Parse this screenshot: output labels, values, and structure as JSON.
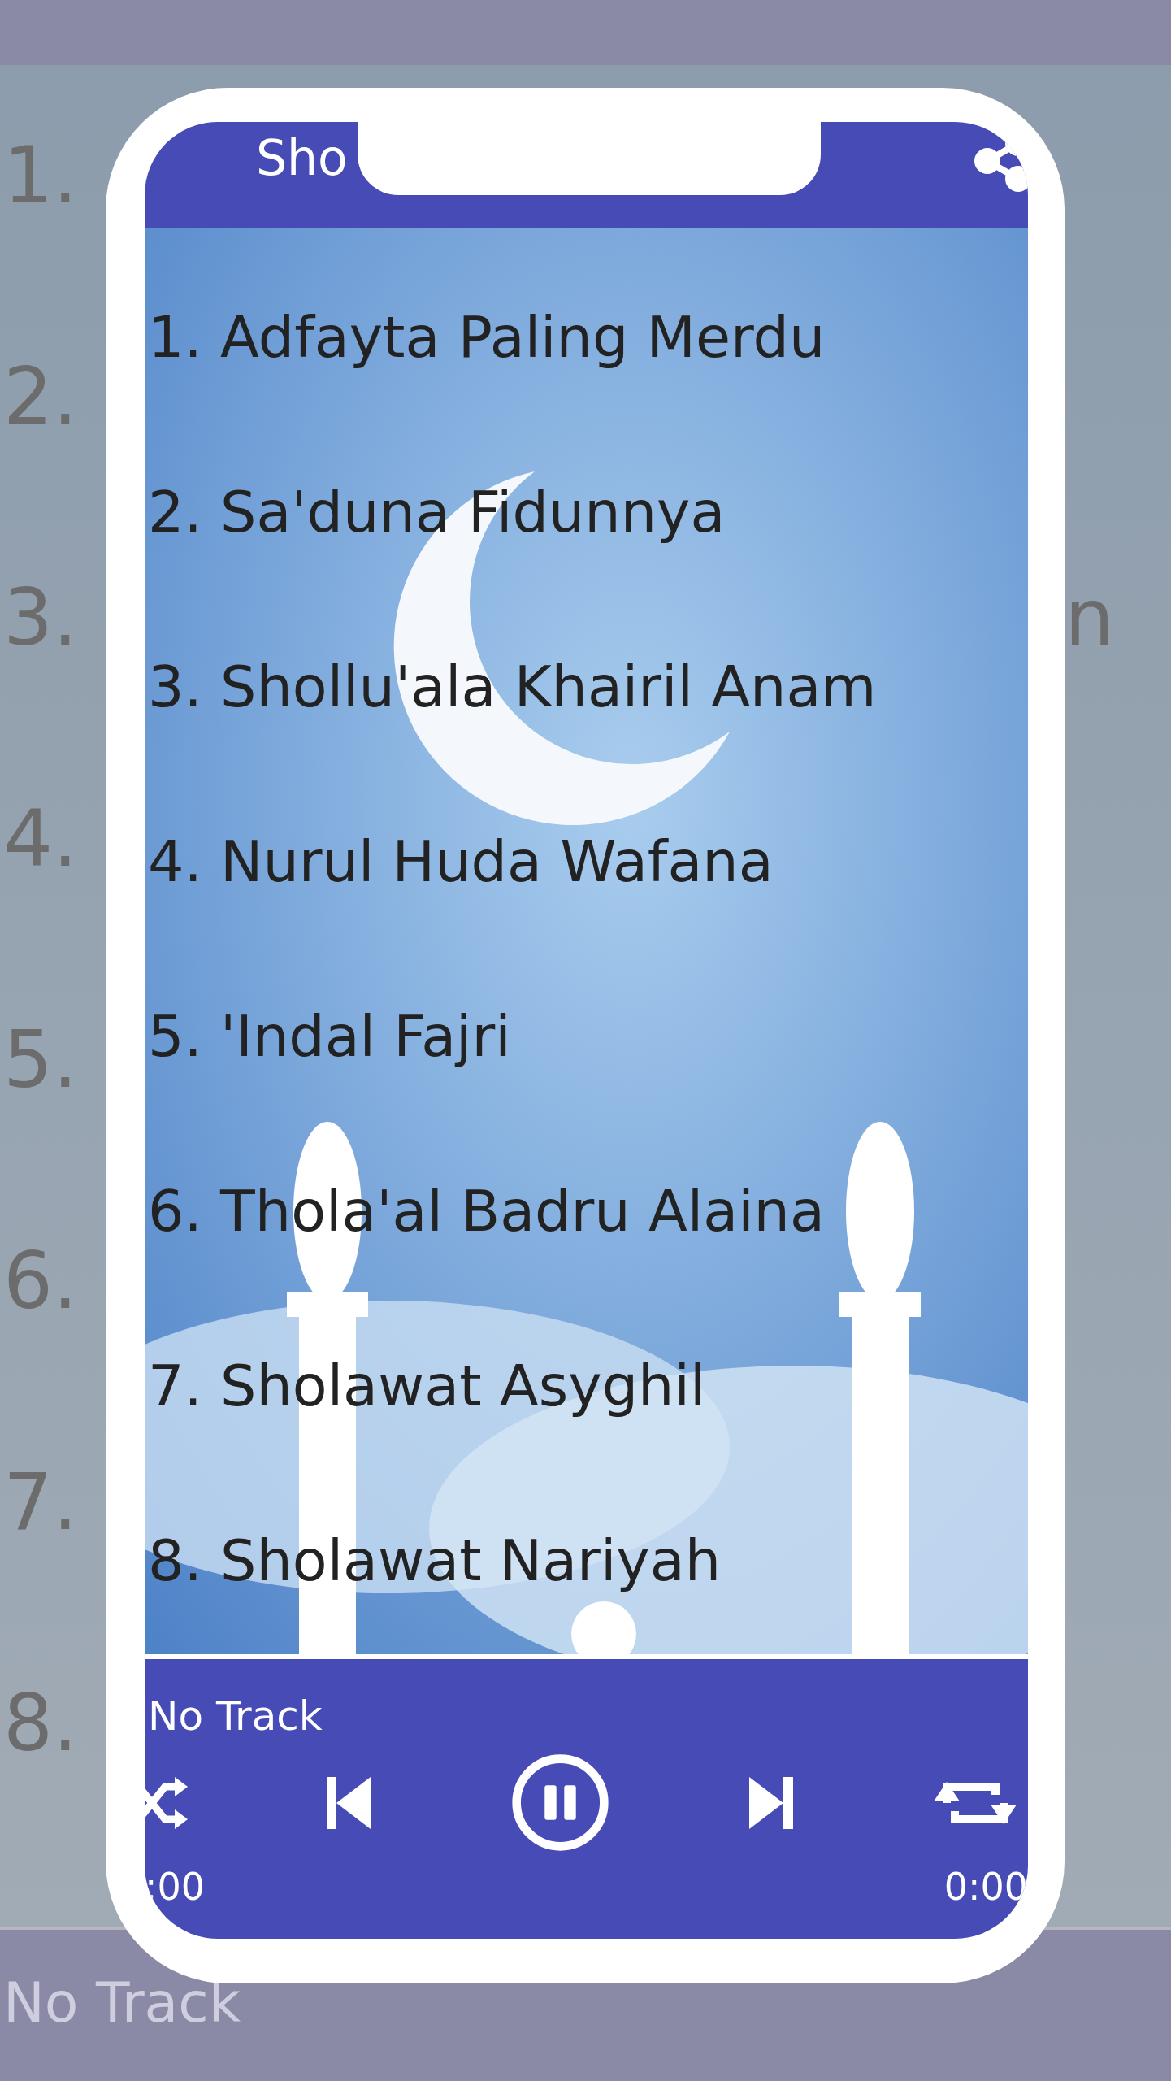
{
  "background": {
    "rows": [
      {
        "label": "1."
      },
      {
        "label": "2."
      },
      {
        "label": "3.",
        "trailing": "n"
      },
      {
        "label": "4."
      },
      {
        "label": "5."
      },
      {
        "label": "6."
      },
      {
        "label": "7."
      },
      {
        "label": "8."
      }
    ],
    "now_playing": "No Track"
  },
  "phone": {
    "app_bar": {
      "title": "Sho"
    },
    "songs": [
      "1. Adfayta Paling Merdu",
      "2. Sa'duna Fidunnya",
      "3. Shollu'ala Khairil Anam",
      "4. Nurul Huda Wafana",
      "5. 'Indal Fajri",
      "6. Thola'al Badru Alaina",
      "7. Sholawat Asyghil",
      "8. Sholawat Nariyah"
    ],
    "player": {
      "track": "No Track",
      "playing": true,
      "elapsed": ":00",
      "duration": "0:00"
    }
  }
}
